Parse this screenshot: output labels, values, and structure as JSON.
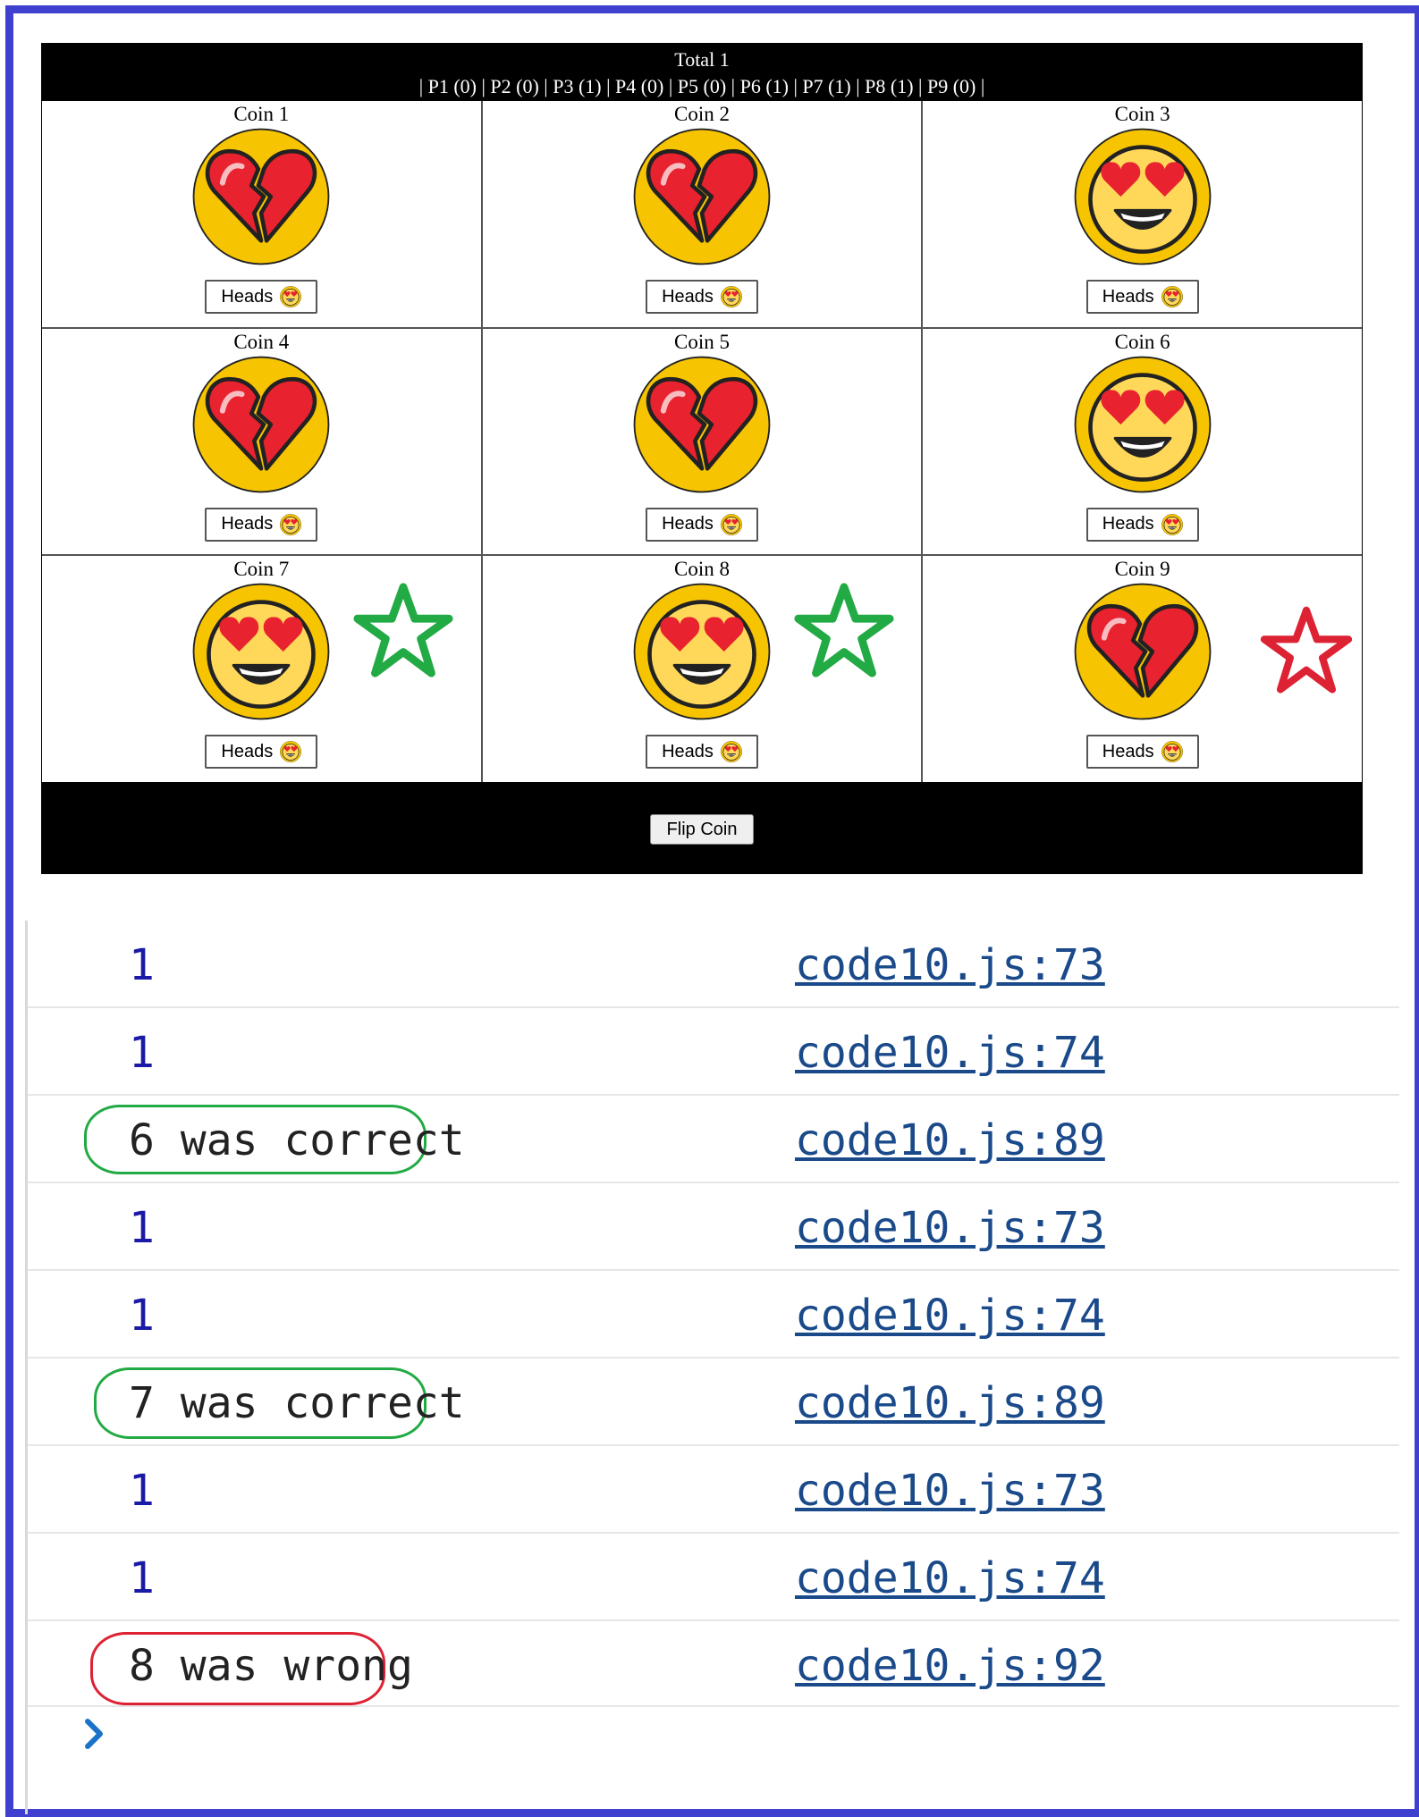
{
  "game": {
    "total": "Total 1",
    "players": "| P1 (0) | P2 (0) | P3 (1) | P4 (0) | P5 (0) | P6 (1) | P7 (1) | P8 (1) | P9 (0) |",
    "flip_label": "Flip Coin",
    "coins": [
      {
        "label": "Coin 1",
        "face": "broken-heart",
        "button": "Heads",
        "star": null
      },
      {
        "label": "Coin 2",
        "face": "broken-heart",
        "button": "Heads",
        "star": null
      },
      {
        "label": "Coin 3",
        "face": "heart-eyes",
        "button": "Heads",
        "star": null
      },
      {
        "label": "Coin 4",
        "face": "broken-heart",
        "button": "Heads",
        "star": null
      },
      {
        "label": "Coin 5",
        "face": "broken-heart",
        "button": "Heads",
        "star": null
      },
      {
        "label": "Coin 6",
        "face": "heart-eyes",
        "button": "Heads",
        "star": null
      },
      {
        "label": "Coin 7",
        "face": "heart-eyes",
        "button": "Heads",
        "star": "green"
      },
      {
        "label": "Coin 8",
        "face": "heart-eyes",
        "button": "Heads",
        "star": "green"
      },
      {
        "label": "Coin 9",
        "face": "broken-heart",
        "button": "Heads",
        "star": "red"
      }
    ]
  },
  "console": {
    "rows": [
      {
        "text": "1",
        "source": "code10.js:73",
        "kind": "num",
        "highlight": null
      },
      {
        "text": "1",
        "source": "code10.js:74",
        "kind": "num",
        "highlight": null
      },
      {
        "text": "6 was correct",
        "source": "code10.js:89",
        "kind": "text",
        "highlight": "green"
      },
      {
        "text": "1",
        "source": "code10.js:73",
        "kind": "num",
        "highlight": null
      },
      {
        "text": "1",
        "source": "code10.js:74",
        "kind": "num",
        "highlight": null
      },
      {
        "text": "7 was correct",
        "source": "code10.js:89",
        "kind": "text",
        "highlight": "green"
      },
      {
        "text": "1",
        "source": "code10.js:73",
        "kind": "num",
        "highlight": null
      },
      {
        "text": "1",
        "source": "code10.js:74",
        "kind": "num",
        "highlight": null
      },
      {
        "text": "8 was wrong",
        "source": "code10.js:92",
        "kind": "text",
        "highlight": "red"
      }
    ],
    "prompt_icon": "chevron-right-icon"
  },
  "colors": {
    "frame": "#4040d0",
    "coin": "#f6c400",
    "heart": "#e8222e",
    "star_green": "#22aa44",
    "star_red": "#dd2233",
    "console_number": "#1a1aa6",
    "console_link": "#1a4a8a"
  }
}
